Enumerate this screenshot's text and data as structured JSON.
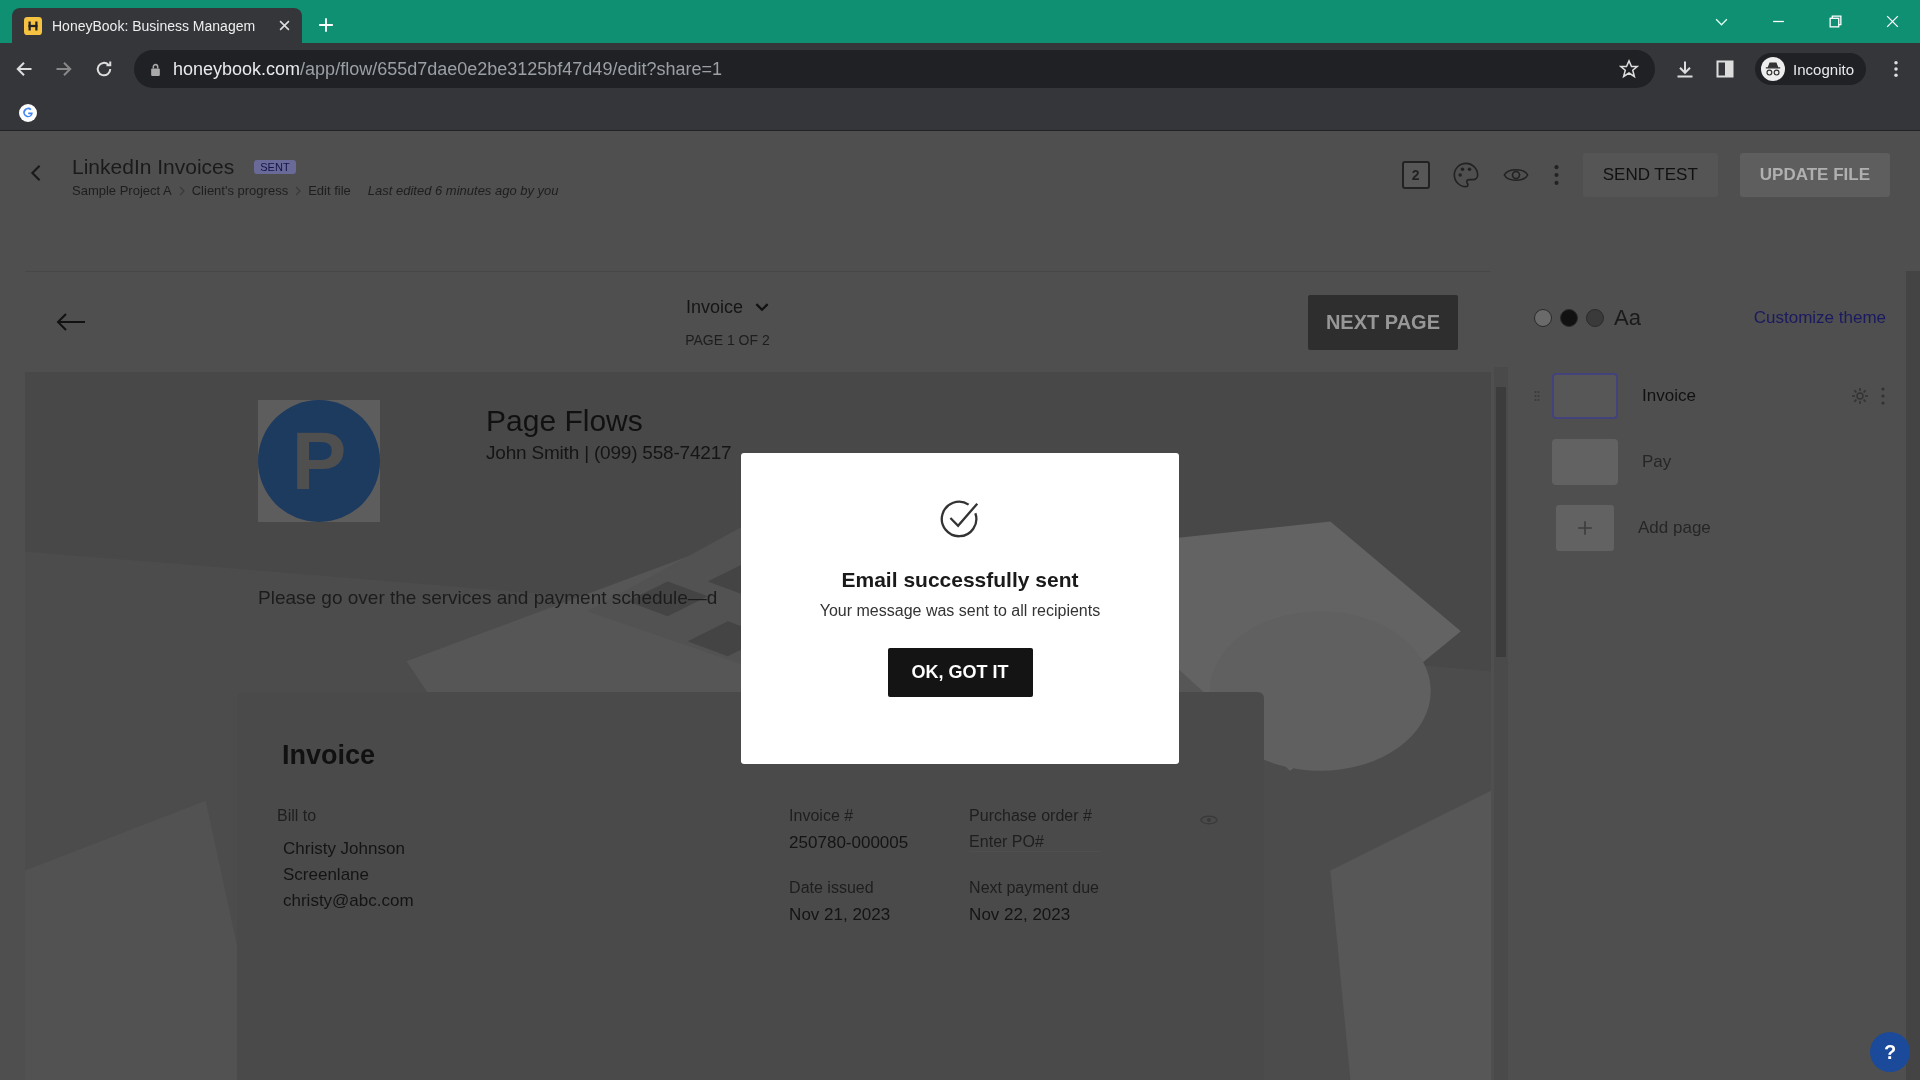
{
  "browser": {
    "tab_title": "HoneyBook: Business Managem",
    "url_host": "honeybook.com",
    "url_path": "/app/flow/655d7dae0e2be3125bf47d49/edit?share=1",
    "profile": "Incognito"
  },
  "header": {
    "title": "LinkedIn Invoices",
    "status": "SENT",
    "breadcrumb": [
      "Sample Project A",
      "Client's progress",
      "Edit file"
    ],
    "last_edited": "Last edited 6 minutes ago by you",
    "pages_count": "2",
    "send_test": "SEND TEST",
    "update_file": "UPDATE FILE"
  },
  "editor": {
    "page_select": "Invoice",
    "page_indicator": "PAGE 1 OF 2",
    "next_page": "NEXT PAGE"
  },
  "document": {
    "logo_letter": "P",
    "company": "Page Flows",
    "contact": "John Smith | (099) 558-74217",
    "intro": "Please go over the services and payment schedule—d",
    "invoice": {
      "title": "Invoice",
      "bill_to_label": "Bill to",
      "bill_to": [
        "Christy Johnson",
        "Screenlane",
        "christy@abc.com"
      ],
      "fields": [
        {
          "kind": "text",
          "label": "Invoice #",
          "value": "250780-000005"
        },
        {
          "kind": "input",
          "label": "Purchase order #",
          "placeholder": "Enter PO#"
        },
        {
          "kind": "text",
          "label": "Date issued",
          "value": "Nov 21, 2023"
        },
        {
          "kind": "text",
          "label": "Next payment due",
          "value": "Nov 22, 2023"
        }
      ]
    }
  },
  "sidebar": {
    "swatches": [
      {
        "color": "#6a6a6a"
      },
      {
        "color": "#111111"
      },
      {
        "color": "#3a3a3a"
      }
    ],
    "font_sample": "Aa",
    "customize": "Customize theme",
    "pages": [
      {
        "name": "Invoice",
        "selected": true
      },
      {
        "name": "Pay",
        "selected": false
      }
    ],
    "add_page": "Add page"
  },
  "modal": {
    "title": "Email successfully sent",
    "message": "Your message was sent to all recipients",
    "button": "OK, GOT IT"
  },
  "help": "?"
}
